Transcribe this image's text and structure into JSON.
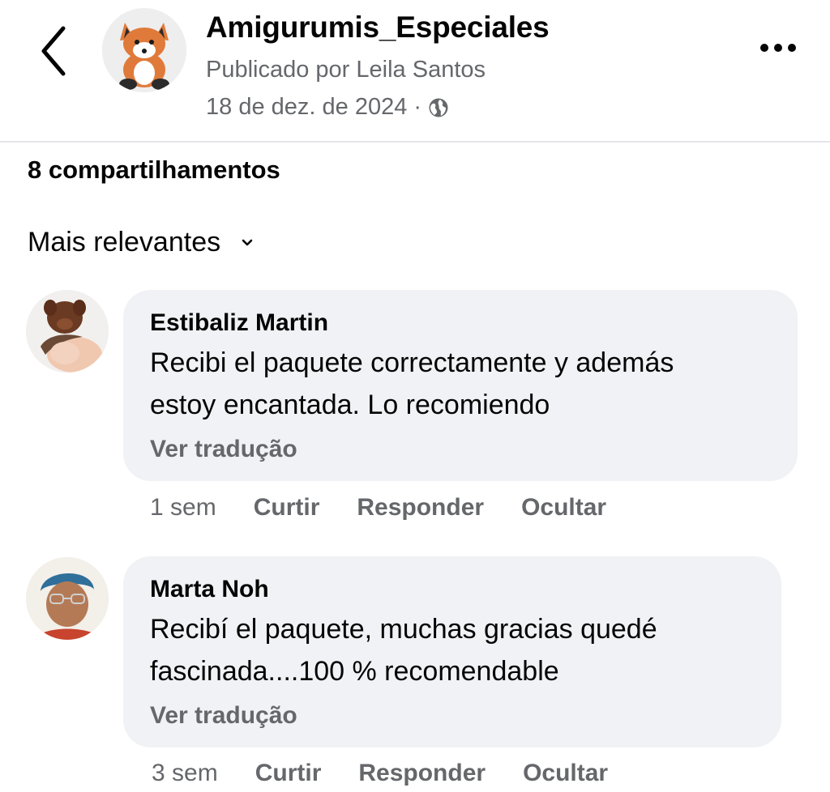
{
  "header": {
    "page_name": "Amigurumis_Especiales",
    "byline": "Publicado por Leila Santos",
    "date": "18 de dez. de 2024",
    "separator": "·",
    "audience_icon": "globe-icon",
    "back_icon": "chevron-left-icon",
    "more_icon": "more-dots-icon"
  },
  "shares_label": "8 compartilhamentos",
  "sort": {
    "label": "Mais relevantes",
    "icon": "chevron-down-icon"
  },
  "comments": [
    {
      "author": "Estibaliz Martin",
      "text_lines": [
        "Recibi el paquete correctamente y además",
        "estoy encantada. Lo recomiendo"
      ],
      "translate": "Ver tradução",
      "age": "1 sem",
      "actions": [
        "Curtir",
        "Responder",
        "Ocultar"
      ]
    },
    {
      "author": "Marta Noh",
      "text_lines": [
        "Recibí el paquete,  muchas gracias quedé",
        "fascinada....100 % recomendable"
      ],
      "translate": "Ver tradução",
      "age": "3 sem",
      "actions": [
        "Curtir",
        "Responder",
        "Ocultar"
      ]
    }
  ],
  "colors": {
    "primary_text": "#050505",
    "secondary_text": "#65676b",
    "bubble": "#f0f2f5",
    "divider": "#e4e6eb"
  }
}
